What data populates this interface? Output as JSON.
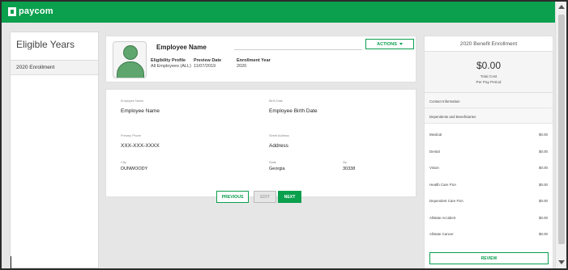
{
  "brand": {
    "name": "paycom"
  },
  "left_panel": {
    "title": "Eligible Years",
    "items": [
      {
        "label": "2020 Enrollment"
      }
    ]
  },
  "employee": {
    "name": "Employee Name",
    "actions_label": "ACTIONS",
    "eligibility_profile_label": "Eligibility Profile",
    "eligibility_profile_value": "All Employees (ALL)",
    "preview_date_label": "Preview Date",
    "preview_date_value": "11/07/2019",
    "enrollment_year_label": "Enrollment Year",
    "enrollment_year_value": "2020"
  },
  "details": {
    "employee_name": {
      "label": "Employee Name",
      "value": "Employee Name"
    },
    "birth_date": {
      "label": "Birth Date",
      "value": "Employee Birth Date"
    },
    "primary_phone": {
      "label": "Primary Phone",
      "value": "XXX-XXX-XXXX"
    },
    "street_address": {
      "label": "Street Address",
      "value": "Address"
    },
    "city": {
      "label": "City",
      "value": "DUNWOODY"
    },
    "state": {
      "label": "State",
      "value": "Georgia"
    },
    "zip": {
      "label": "Zip",
      "value": "30338"
    }
  },
  "buttons": {
    "previous": "PREVIOUS",
    "edit": "EDIT",
    "next": "NEXT",
    "review": "REVIEW"
  },
  "summary": {
    "title": "2020 Benefit Enrollment",
    "total_cost": "$0.00",
    "total_cost_label": "Total Cost",
    "period_label": "Per Pay Period",
    "links": [
      "Contact Information",
      "Dependents and Beneficiaries"
    ],
    "benefits": [
      {
        "name": "Medical",
        "amount": "$0.00"
      },
      {
        "name": "Dental",
        "amount": "$0.00"
      },
      {
        "name": "Vision",
        "amount": "$0.00"
      },
      {
        "name": "Health Care FSA",
        "amount": "$0.00"
      },
      {
        "name": "Dependent Care FSA",
        "amount": "$0.00"
      },
      {
        "name": "Allstate Accident",
        "amount": "$0.00"
      },
      {
        "name": "Allstate Cancer",
        "amount": "$0.00"
      }
    ]
  },
  "colors": {
    "brand_green": "#0aa04e",
    "background": "#e6e6e6"
  }
}
